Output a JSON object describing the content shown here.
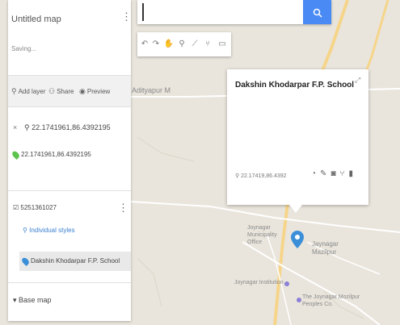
{
  "search": {
    "value": "",
    "placeholder": "",
    "button_icon": "search-icon"
  },
  "toolbar": {
    "icons": [
      "undo-icon",
      "redo-icon",
      "hand-icon",
      "marker-icon",
      "line-icon",
      "directions-icon",
      "ruler-icon"
    ]
  },
  "panel": {
    "title": "Untitled map",
    "status": "Saving...",
    "actions": {
      "add_layer": "Add layer",
      "share": "Share",
      "preview": "Preview"
    },
    "search_result": {
      "query": "22.1741961,86.4392195",
      "item": "22.1741961,86.4392195"
    },
    "layer": {
      "name": "5251361027",
      "style": "Individual styles",
      "item": "Dakshin Khodarpar F.P. School"
    },
    "base_map": "Base map"
  },
  "map": {
    "labels": {
      "aditypur": "Adityapur M",
      "joynagar_mun": "Joynagar Municipality Office",
      "jayanagar": "Jaynagar Mazilpur",
      "institution": "Joynagar Institution",
      "bank": "The Joynagar Mozilpur Peoples Co."
    }
  },
  "popup": {
    "title": "Dakshin Khodarpar F.P. School",
    "coord": "22.17419,86.4392"
  },
  "colors": {
    "accent": "#4a8af4",
    "map_bg": "#e9e5dc",
    "green_pin": "#5cc44c",
    "blue_pin": "#3b8fd9"
  }
}
